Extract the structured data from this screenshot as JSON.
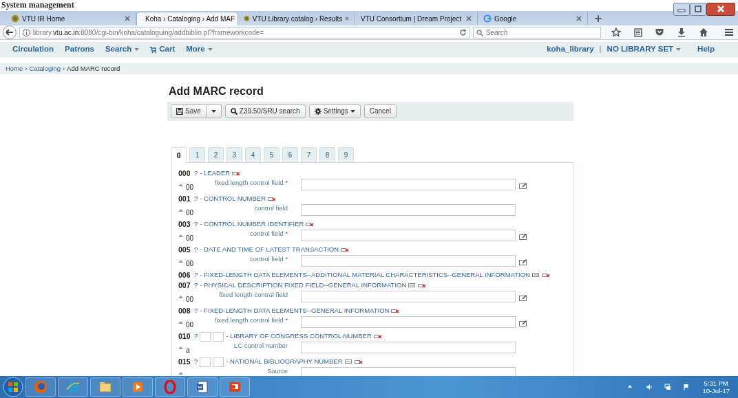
{
  "document_heading": "System management",
  "browser": {
    "tabs": [
      {
        "title": "VTU IR Home",
        "selected": false
      },
      {
        "title": "Koha › Cataloging › Add MAF",
        "selected": true
      },
      {
        "title": "VTU Library catalog › Results",
        "selected": false
      },
      {
        "title": "VTU Consortium | Dream Project",
        "selected": false
      },
      {
        "title": "Google",
        "selected": false
      }
    ],
    "url": "library.**vtu.ac.in**:8080/cgi-bin/koha/cataloguing/addbiblio.pl?frameworkcode=",
    "search_placeholder": "Search"
  },
  "koha_nav": {
    "menu": [
      {
        "label": "Circulation",
        "kind": "plain"
      },
      {
        "label": "Patrons",
        "kind": "plain"
      },
      {
        "label": "Search",
        "kind": "dropdown"
      },
      {
        "label": "Cart",
        "kind": "cart"
      },
      {
        "label": "More",
        "kind": "dropdown"
      }
    ],
    "user": "koha_library",
    "separator": "|",
    "library": "NO LIBRARY SET",
    "help": "Help"
  },
  "breadcrumbs": {
    "separator": "›",
    "items": [
      {
        "label": "Home",
        "link": true
      },
      {
        "label": "Cataloging",
        "link": true
      },
      {
        "label": "Add MARC record",
        "link": false
      }
    ]
  },
  "title": "Add MARC record",
  "toolbar": [
    {
      "kind": "save",
      "label": "Save"
    },
    {
      "kind": "search",
      "label": "Z39.50/SRU search"
    },
    {
      "kind": "settings",
      "label": "Settings"
    },
    {
      "kind": "plain",
      "label": "Cancel"
    }
  ],
  "marc_tabs": [
    {
      "label": "0",
      "selected": true
    },
    {
      "label": "1",
      "selected": false
    },
    {
      "label": "2",
      "selected": false
    },
    {
      "label": "3",
      "selected": false
    },
    {
      "label": "4",
      "selected": false
    },
    {
      "label": "5",
      "selected": false
    },
    {
      "label": "6",
      "selected": false
    },
    {
      "label": "7",
      "selected": false
    },
    {
      "label": "8",
      "selected": false
    },
    {
      "label": "9",
      "selected": false
    }
  ],
  "fields": [
    {
      "tag": "000",
      "help": "?",
      "name": "- LEADER",
      "indicators": false,
      "clonable": false,
      "subfields": [
        {
          "code": "00",
          "label": "fixed length control field",
          "required_mark": "*",
          "plugin": true
        }
      ]
    },
    {
      "tag": "001",
      "help": "?",
      "name": "- CONTROL NUMBER",
      "indicators": false,
      "clonable": false,
      "subfields": [
        {
          "code": "00",
          "label": "control field",
          "plugin": false
        }
      ]
    },
    {
      "tag": "003",
      "help": "?",
      "name": "- CONTROL NUMBER IDENTIFIER",
      "indicators": false,
      "clonable": false,
      "subfields": [
        {
          "code": "00",
          "label": "control field",
          "required_mark": "*",
          "plugin": true
        }
      ]
    },
    {
      "tag": "005",
      "help": "?",
      "name": "- DATE AND TIME OF LATEST TRANSACTION",
      "indicators": false,
      "clonable": false,
      "subfields": [
        {
          "code": "00",
          "label": "control field",
          "required_mark": "*",
          "plugin": true
        }
      ]
    },
    {
      "tag": "006",
      "help": "?",
      "name": "- FIXED-LENGTH DATA ELEMENTS--ADDITIONAL MATERIAL CHARACTERISTICS--GENERAL INFORMATION",
      "indicators": false,
      "clonable": true
    },
    {
      "tag": "007",
      "help": "?",
      "name": "- PHYSICAL DESCRIPTION FIXED FIELD--GENERAL INFORMATION",
      "indicators": false,
      "clonable": true,
      "subfields": [
        {
          "code": "00",
          "label": "fixed length control field",
          "plugin": true
        }
      ]
    },
    {
      "tag": "008",
      "help": "?",
      "name": "- FIXED-LENGTH DATA ELEMENTS--GENERAL INFORMATION",
      "indicators": false,
      "clonable": false,
      "subfields": [
        {
          "code": "00",
          "label": "fixed length control field",
          "required_mark": "*",
          "plugin": true
        }
      ]
    },
    {
      "tag": "010",
      "help": "?",
      "name": "- LIBRARY OF CONGRESS CONTROL NUMBER",
      "indicators": true,
      "clonable": false,
      "subfields": [
        {
          "code": "a",
          "label": "LC control number",
          "plugin": false
        }
      ]
    },
    {
      "tag": "015",
      "help": "?",
      "name": "- NATIONAL BIBLIOGRAPHY NUMBER",
      "indicators": true,
      "clonable": true,
      "subfields": [
        {
          "label": "Source",
          "plugin": false
        }
      ]
    }
  ],
  "clock": {
    "time": "5:31 PM",
    "date": "10-Jul-17"
  }
}
